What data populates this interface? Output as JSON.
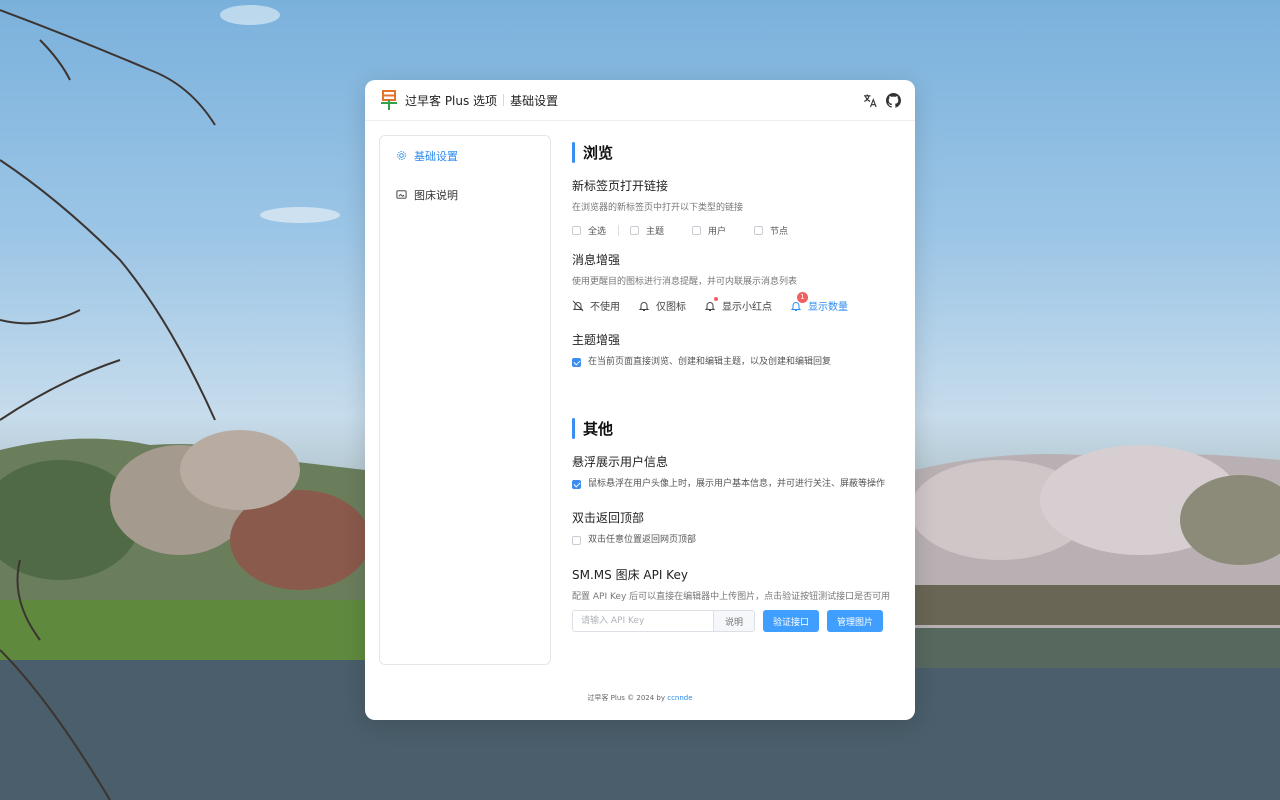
{
  "app": {
    "title": "过早客 Plus 选项",
    "page_name": "基础设置",
    "translate_icon": "translate-icon",
    "github_icon": "github-icon",
    "brand_color": "#2d8cf0"
  },
  "sidebar": {
    "items": [
      {
        "label": "基础设置",
        "icon": "gear-icon",
        "active": true
      },
      {
        "label": "图床说明",
        "icon": "image-icon",
        "active": false
      }
    ]
  },
  "browse": {
    "title": "浏览",
    "new_tab": {
      "title": "新标签页打开链接",
      "desc": "在浏览器的新标签页中打开以下类型的链接",
      "options": [
        "全选",
        "主题",
        "用户",
        "节点"
      ]
    },
    "message": {
      "title": "消息增强",
      "desc": "使用更醒目的图标进行消息提醒，并可内联展示消息列表",
      "options": [
        "不使用",
        "仅图标",
        "显示小红点",
        "显示数量"
      ],
      "badge_count": "1"
    },
    "topic": {
      "title": "主题增强",
      "check_label": "在当前页面直接浏览、创建和编辑主题，以及创建和编辑回复",
      "checked": true
    }
  },
  "other": {
    "title": "其他",
    "hover": {
      "title": "悬浮展示用户信息",
      "check_label": "鼠标悬浮在用户头像上时，展示用户基本信息，并可进行关注、屏蔽等操作",
      "checked": true
    },
    "dblclick": {
      "title": "双击返回顶部",
      "check_label": "双击任意位置返回网页顶部",
      "checked": false
    },
    "api": {
      "title": "SM.MS 图床 API Key",
      "desc": "配置 API Key 后可以直接在编辑器中上传图片，点击验证按钮测试接口是否可用",
      "placeholder": "请输入 API Key",
      "suffix": "说明",
      "verify_label": "验证接口",
      "manage_label": "管理图片"
    }
  },
  "footer": {
    "text": "过早客 Plus © 2024 by",
    "author": "ccnnde"
  }
}
